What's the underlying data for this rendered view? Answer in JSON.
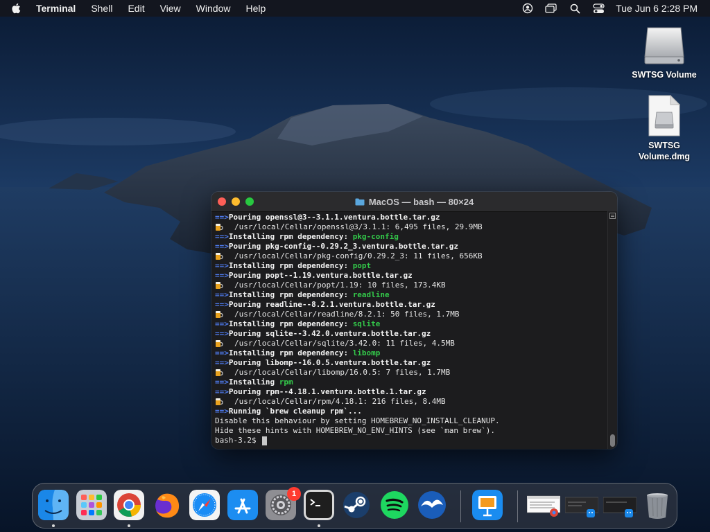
{
  "menubar": {
    "app_name": "Terminal",
    "menus": [
      "Shell",
      "Edit",
      "View",
      "Window",
      "Help"
    ],
    "clock": "Tue Jun 6  2:28 PM",
    "status_icons": [
      "user-icon",
      "screen-mirroring-icon",
      "search-icon",
      "control-center-icon"
    ]
  },
  "desktop": {
    "icons": [
      {
        "label": "SWTSG Volume",
        "icon": "drive-icon"
      },
      {
        "label_lines": [
          "SWTSG",
          "Volume.dmg"
        ],
        "icon": "dmg-file-icon"
      }
    ]
  },
  "terminal": {
    "title": "MacOS — bash — 80×24",
    "lines": [
      {
        "kind": "arrow",
        "text": "Pouring openssl@3--3.1.1.ventura.bottle.tar.gz"
      },
      {
        "kind": "beer",
        "text": "/usr/local/Cellar/openssl@3/3.1.1: 6,495 files, 29.9MB"
      },
      {
        "kind": "dep",
        "text": "Installing rpm dependency: ",
        "pkg": "pkg-config"
      },
      {
        "kind": "arrow",
        "text": "Pouring pkg-config--0.29.2_3.ventura.bottle.tar.gz"
      },
      {
        "kind": "beer",
        "text": "/usr/local/Cellar/pkg-config/0.29.2_3: 11 files, 656KB"
      },
      {
        "kind": "dep",
        "text": "Installing rpm dependency: ",
        "pkg": "popt"
      },
      {
        "kind": "arrow",
        "text": "Pouring popt--1.19.ventura.bottle.tar.gz"
      },
      {
        "kind": "beer",
        "text": "/usr/local/Cellar/popt/1.19: 10 files, 173.4KB"
      },
      {
        "kind": "dep",
        "text": "Installing rpm dependency: ",
        "pkg": "readline"
      },
      {
        "kind": "arrow",
        "text": "Pouring readline--8.2.1.ventura.bottle.tar.gz"
      },
      {
        "kind": "beer",
        "text": "/usr/local/Cellar/readline/8.2.1: 50 files, 1.7MB"
      },
      {
        "kind": "dep",
        "text": "Installing rpm dependency: ",
        "pkg": "sqlite"
      },
      {
        "kind": "arrow",
        "text": "Pouring sqlite--3.42.0.ventura.bottle.tar.gz"
      },
      {
        "kind": "beer",
        "text": "/usr/local/Cellar/sqlite/3.42.0: 11 files, 4.5MB"
      },
      {
        "kind": "dep",
        "text": "Installing rpm dependency: ",
        "pkg": "libomp"
      },
      {
        "kind": "arrow",
        "text": "Pouring libomp--16.0.5.ventura.bottle.tar.gz"
      },
      {
        "kind": "beer",
        "text": "/usr/local/Cellar/libomp/16.0.5: 7 files, 1.7MB"
      },
      {
        "kind": "dep",
        "text": "Installing ",
        "pkg": "rpm"
      },
      {
        "kind": "arrow",
        "text": "Pouring rpm--4.18.1.ventura.bottle.1.tar.gz"
      },
      {
        "kind": "beer",
        "text": "/usr/local/Cellar/rpm/4.18.1: 216 files, 8.4MB"
      },
      {
        "kind": "arrow",
        "text": "Running `brew cleanup rpm`..."
      },
      {
        "kind": "plain",
        "text": "Disable this behaviour by setting HOMEBREW_NO_INSTALL_CLEANUP."
      },
      {
        "kind": "plain",
        "text": "Hide these hints with HOMEBREW_NO_ENV_HINTS (see `man brew`)."
      },
      {
        "kind": "prompt",
        "text": "bash-3.2$ "
      }
    ],
    "arrow_glyph": "==>"
  },
  "dock": {
    "apps": [
      {
        "name": "Finder",
        "icon": "finder-icon",
        "running": true
      },
      {
        "name": "Launchpad",
        "icon": "launchpad-icon",
        "running": false
      },
      {
        "name": "Google Chrome",
        "icon": "chrome-icon",
        "running": true
      },
      {
        "name": "Firefox",
        "icon": "firefox-icon",
        "running": false
      },
      {
        "name": "Safari",
        "icon": "safari-icon",
        "running": false
      },
      {
        "name": "App Store",
        "icon": "app-store-icon",
        "running": false
      },
      {
        "name": "System Settings",
        "icon": "settings-icon",
        "running": false,
        "badge": "1"
      },
      {
        "name": "Terminal",
        "icon": "terminal-icon",
        "running": true
      },
      {
        "name": "Steam",
        "icon": "steam-icon",
        "running": false
      },
      {
        "name": "Spotify",
        "icon": "spotify-icon",
        "running": false
      },
      {
        "name": "OpenOffice",
        "icon": "openoffice-icon",
        "running": false
      },
      {
        "name": "Keynote",
        "icon": "keynote-icon",
        "running": false
      },
      {
        "name": "Chrome window",
        "icon": "chrome-window-thumbnail-icon",
        "running": false
      },
      {
        "name": "Finder window",
        "icon": "finder-window-thumbnail-icon",
        "running": false
      },
      {
        "name": "Finder window 2",
        "icon": "finder-window-thumbnail-icon",
        "running": false
      },
      {
        "name": "Trash",
        "icon": "trash-icon",
        "running": false
      }
    ]
  }
}
